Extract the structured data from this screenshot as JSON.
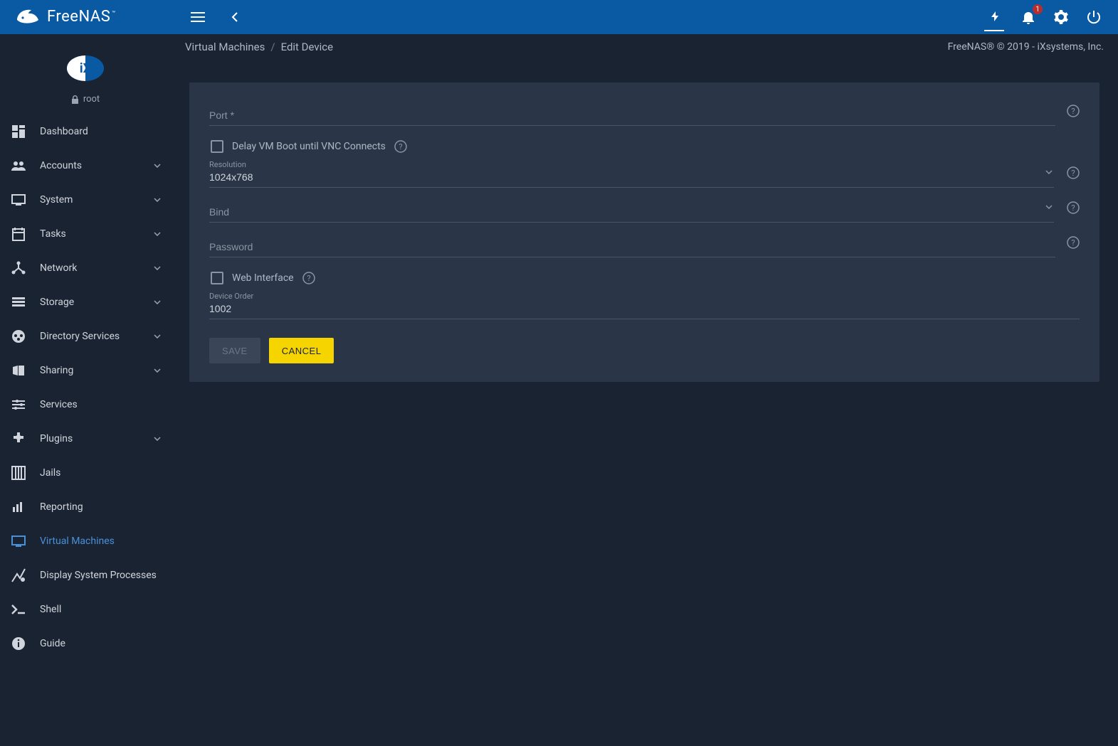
{
  "brand": "FreeNAS",
  "user": {
    "name": "root"
  },
  "topbar": {
    "notification_count": "1"
  },
  "breadcrumb": {
    "parent": "Virtual Machines",
    "current": "Edit Device",
    "copyright": "FreeNAS® © 2019 - iXsystems, Inc."
  },
  "sidebar": [
    {
      "id": "dashboard",
      "label": "Dashboard",
      "expandable": false
    },
    {
      "id": "accounts",
      "label": "Accounts",
      "expandable": true
    },
    {
      "id": "system",
      "label": "System",
      "expandable": true
    },
    {
      "id": "tasks",
      "label": "Tasks",
      "expandable": true
    },
    {
      "id": "network",
      "label": "Network",
      "expandable": true
    },
    {
      "id": "storage",
      "label": "Storage",
      "expandable": true
    },
    {
      "id": "directory",
      "label": "Directory Services",
      "expandable": true
    },
    {
      "id": "sharing",
      "label": "Sharing",
      "expandable": true
    },
    {
      "id": "services",
      "label": "Services",
      "expandable": false
    },
    {
      "id": "plugins",
      "label": "Plugins",
      "expandable": true
    },
    {
      "id": "jails",
      "label": "Jails",
      "expandable": false
    },
    {
      "id": "reporting",
      "label": "Reporting",
      "expandable": false
    },
    {
      "id": "vm",
      "label": "Virtual Machines",
      "expandable": false,
      "active": true
    },
    {
      "id": "procs",
      "label": "Display System Processes",
      "expandable": false
    },
    {
      "id": "shell",
      "label": "Shell",
      "expandable": false
    },
    {
      "id": "guide",
      "label": "Guide",
      "expandable": false
    }
  ],
  "form": {
    "port_label": "Port *",
    "port_value": "",
    "delay_label": "Delay VM Boot until VNC Connects",
    "delay_checked": false,
    "resolution_label": "Resolution",
    "resolution_value": "1024x768",
    "bind_label": "Bind",
    "bind_value": "",
    "password_label": "Password",
    "password_value": "",
    "web_label": "Web Interface",
    "web_checked": false,
    "order_label": "Device Order",
    "order_value": "1002",
    "save_label": "Save",
    "cancel_label": "Cancel"
  }
}
